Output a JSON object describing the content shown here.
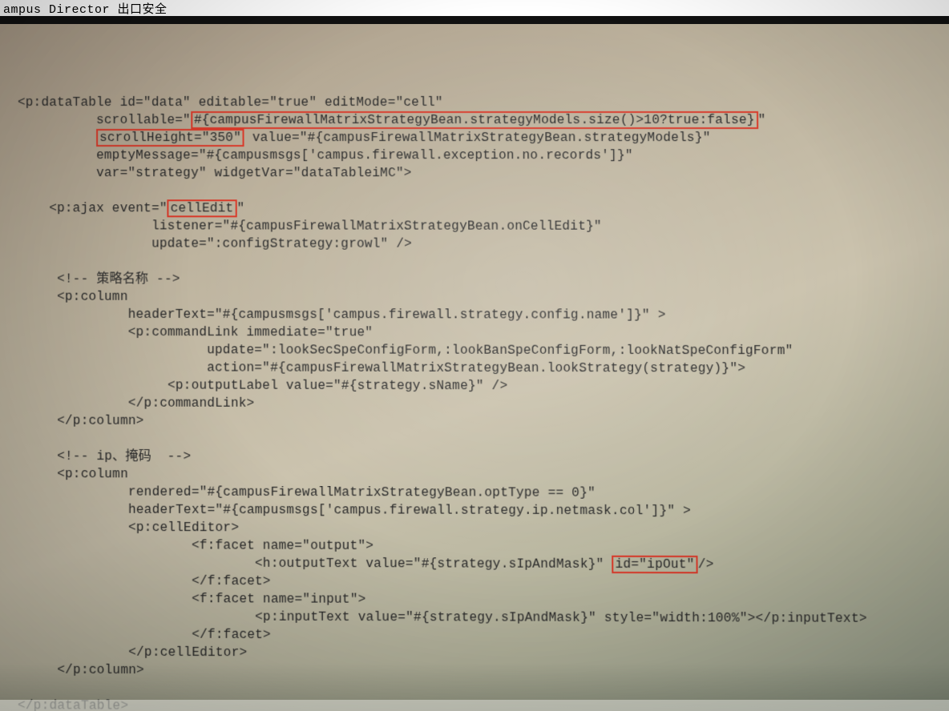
{
  "topstrip": "ampus Director 出口安全",
  "code": {
    "l1": "<p:dataTable id=\"data\" editable=\"true\" editMode=\"cell\"",
    "l2a": "          scrollable=\"",
    "l2b": "#{campusFirewallMatrixStrategyBean.strategyModels.size()>10?true:false}",
    "l2c": "\"",
    "l3a": "          ",
    "l3b": "scrollHeight=\"350\"",
    "l3c": " value=\"#{campusFirewallMatrixStrategyBean.strategyModels}\"",
    "l4": "          emptyMessage=\"#{campusmsgs['campus.firewall.exception.no.records']}\"",
    "l5": "          var=\"strategy\" widgetVar=\"dataTableiMC\">",
    "l6": "",
    "l7a": "    <p:ajax event=\"",
    "l7b": "cellEdit",
    "l7c": "\"",
    "l8": "                 listener=\"#{campusFirewallMatrixStrategyBean.onCellEdit}\"",
    "l9": "                 update=\":configStrategy:growl\" />",
    "l10": "",
    "l11": "     <!-- 策略名称 -->",
    "l12": "     <p:column",
    "l13": "              headerText=\"#{campusmsgs['campus.firewall.strategy.config.name']}\" >",
    "l14": "              <p:commandLink immediate=\"true\"",
    "l15": "                        update=\":lookSecSpeConfigForm,:lookBanSpeConfigForm,:lookNatSpeConfigForm\"",
    "l16": "                        action=\"#{campusFirewallMatrixStrategyBean.lookStrategy(strategy)}\">",
    "l17": "                   <p:outputLabel value=\"#{strategy.sName}\" />",
    "l18": "              </p:commandLink>",
    "l19": "     </p:column>",
    "l20": "",
    "l21": "     <!-- ip、掩码  -->",
    "l22": "     <p:column",
    "l23": "              rendered=\"#{campusFirewallMatrixStrategyBean.optType == 0}\"",
    "l24": "              headerText=\"#{campusmsgs['campus.firewall.strategy.ip.netmask.col']}\" >",
    "l25": "              <p:cellEditor>",
    "l26": "                      <f:facet name=\"output\">",
    "l27a": "                              <h:outputText value=\"#{strategy.sIpAndMask}\" ",
    "l27b": "id=\"ipOut\"",
    "l27c": "/>",
    "l28": "                      </f:facet>",
    "l29": "                      <f:facet name=\"input\">",
    "l30": "                              <p:inputText value=\"#{strategy.sIpAndMask}\" style=\"width:100%\"></p:inputText>",
    "l31": "                      </f:facet>",
    "l32": "              </p:cellEditor>",
    "l33": "     </p:column>",
    "l34": "",
    "l35": "</p:dataTable>"
  }
}
